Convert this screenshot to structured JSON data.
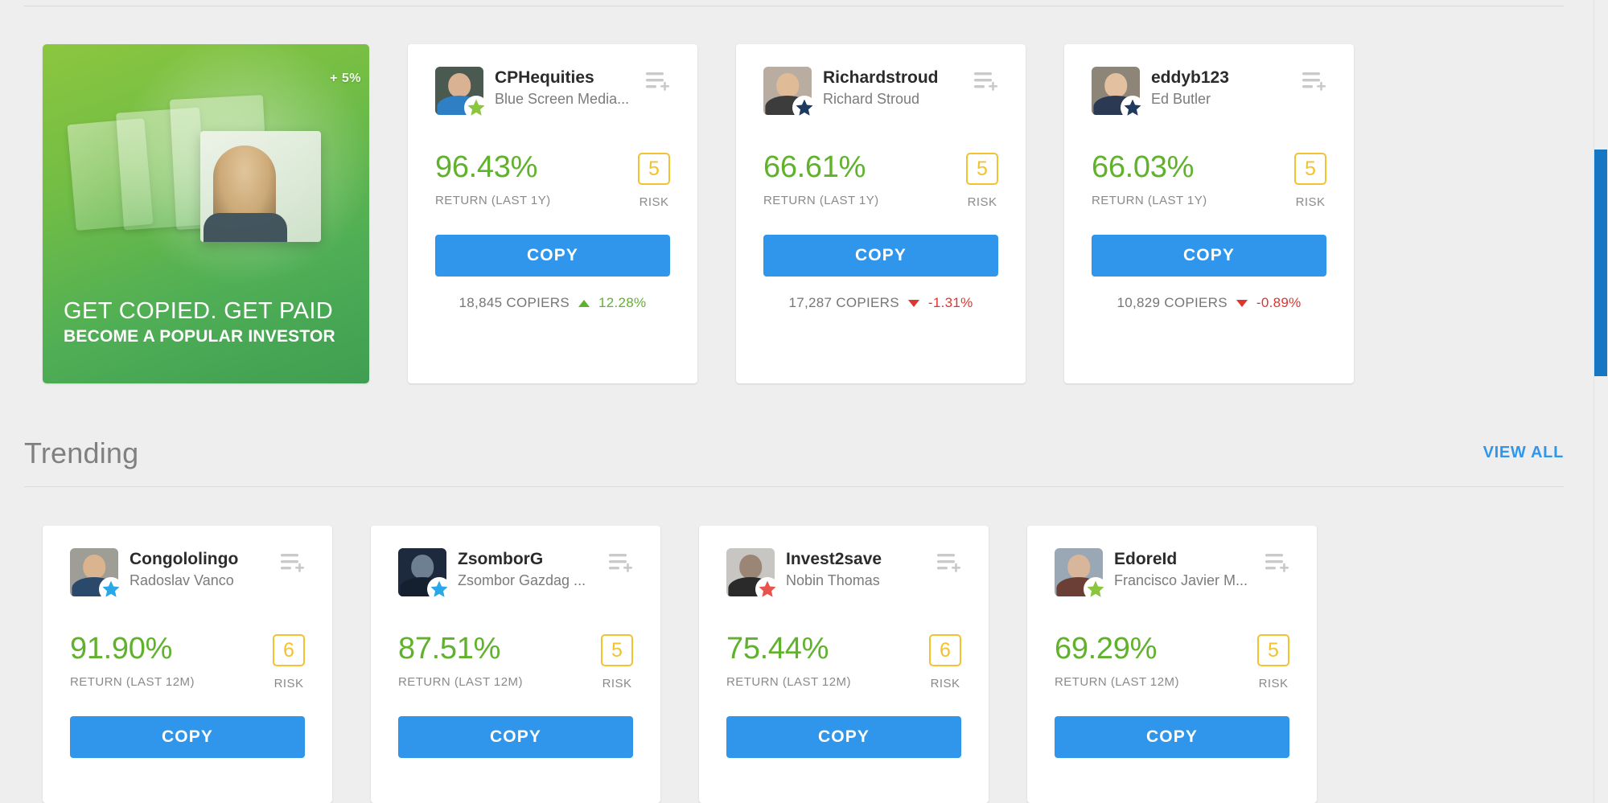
{
  "promo": {
    "line1": "GET COPIED. GET PAID",
    "line2": "BECOME A POPULAR INVESTOR",
    "badge": "+ 5%"
  },
  "section": {
    "title": "Trending",
    "view_all": "VIEW ALL"
  },
  "labels": {
    "copy": "COPY",
    "risk": "RISK",
    "copiers_suffix": "COPIERS"
  },
  "colors": {
    "positive": "#60b22c",
    "negative": "#e0342f",
    "accent": "#2f96eb",
    "risk": "#f2c230",
    "scrollbar": "#1577c4"
  },
  "featured_cards": [
    {
      "username": "CPHequities",
      "fullname": "Blue Screen Media...",
      "return_value": "96.43%",
      "return_label": "RETURN (LAST 1Y)",
      "risk": "5",
      "risk_label": "RISK",
      "copy_label": "COPY",
      "copiers": "18,845 COPIERS",
      "change": "12.28%",
      "direction": "up",
      "star_color": "#8cc63f",
      "avatar": {
        "bg": "#4a5a50",
        "skin": "#d8b292",
        "cloth": "#2f7fc4"
      }
    },
    {
      "username": "Richardstroud",
      "fullname": "Richard Stroud",
      "return_value": "66.61%",
      "return_label": "RETURN (LAST 1Y)",
      "risk": "5",
      "risk_label": "RISK",
      "copy_label": "COPY",
      "copiers": "17,287 COPIERS",
      "change": "-1.31%",
      "direction": "down",
      "star_color": "#1f3a5f",
      "avatar": {
        "bg": "#b9aca0",
        "skin": "#e0bb98",
        "cloth": "#3c3c3c"
      }
    },
    {
      "username": "eddyb123",
      "fullname": "Ed Butler",
      "return_value": "66.03%",
      "return_label": "RETURN (LAST 1Y)",
      "risk": "5",
      "risk_label": "RISK",
      "copy_label": "COPY",
      "copiers": "10,829 COPIERS",
      "change": "-0.89%",
      "direction": "down",
      "star_color": "#1f3a5f",
      "avatar": {
        "bg": "#8d8578",
        "skin": "#e3c0a0",
        "cloth": "#2b3a52"
      }
    }
  ],
  "trending_cards": [
    {
      "username": "Congololingo",
      "fullname": "Radoslav Vanco",
      "return_value": "91.90%",
      "return_label": "RETURN (LAST 12M)",
      "risk": "6",
      "risk_label": "RISK",
      "copy_label": "COPY",
      "star_color": "#29a7e8",
      "avatar": {
        "bg": "#9e9e96",
        "skin": "#d9b48f",
        "cloth": "#2b4a6b"
      }
    },
    {
      "username": "ZsomborG",
      "fullname": "Zsombor Gazdag ...",
      "return_value": "87.51%",
      "return_label": "RETURN (LAST 12M)",
      "risk": "5",
      "risk_label": "RISK",
      "copy_label": "COPY",
      "star_color": "#29a7e8",
      "avatar": {
        "bg": "#1d2a3d",
        "skin": "#6f7f92",
        "cloth": "#14202f"
      }
    },
    {
      "username": "Invest2save",
      "fullname": "Nobin Thomas",
      "return_value": "75.44%",
      "return_label": "RETURN (LAST 12M)",
      "risk": "6",
      "risk_label": "RISK",
      "copy_label": "COPY",
      "star_color": "#e8544b",
      "avatar": {
        "bg": "#c8c6c2",
        "skin": "#9b8574",
        "cloth": "#2a2a2a"
      }
    },
    {
      "username": "EdoreId",
      "fullname": "Francisco Javier M...",
      "return_value": "69.29%",
      "return_label": "RETURN (LAST 12M)",
      "risk": "5",
      "risk_label": "RISK",
      "copy_label": "COPY",
      "star_color": "#8cc63f",
      "avatar": {
        "bg": "#9aa7b4",
        "skin": "#d7b69b",
        "cloth": "#6b3f35"
      }
    }
  ]
}
